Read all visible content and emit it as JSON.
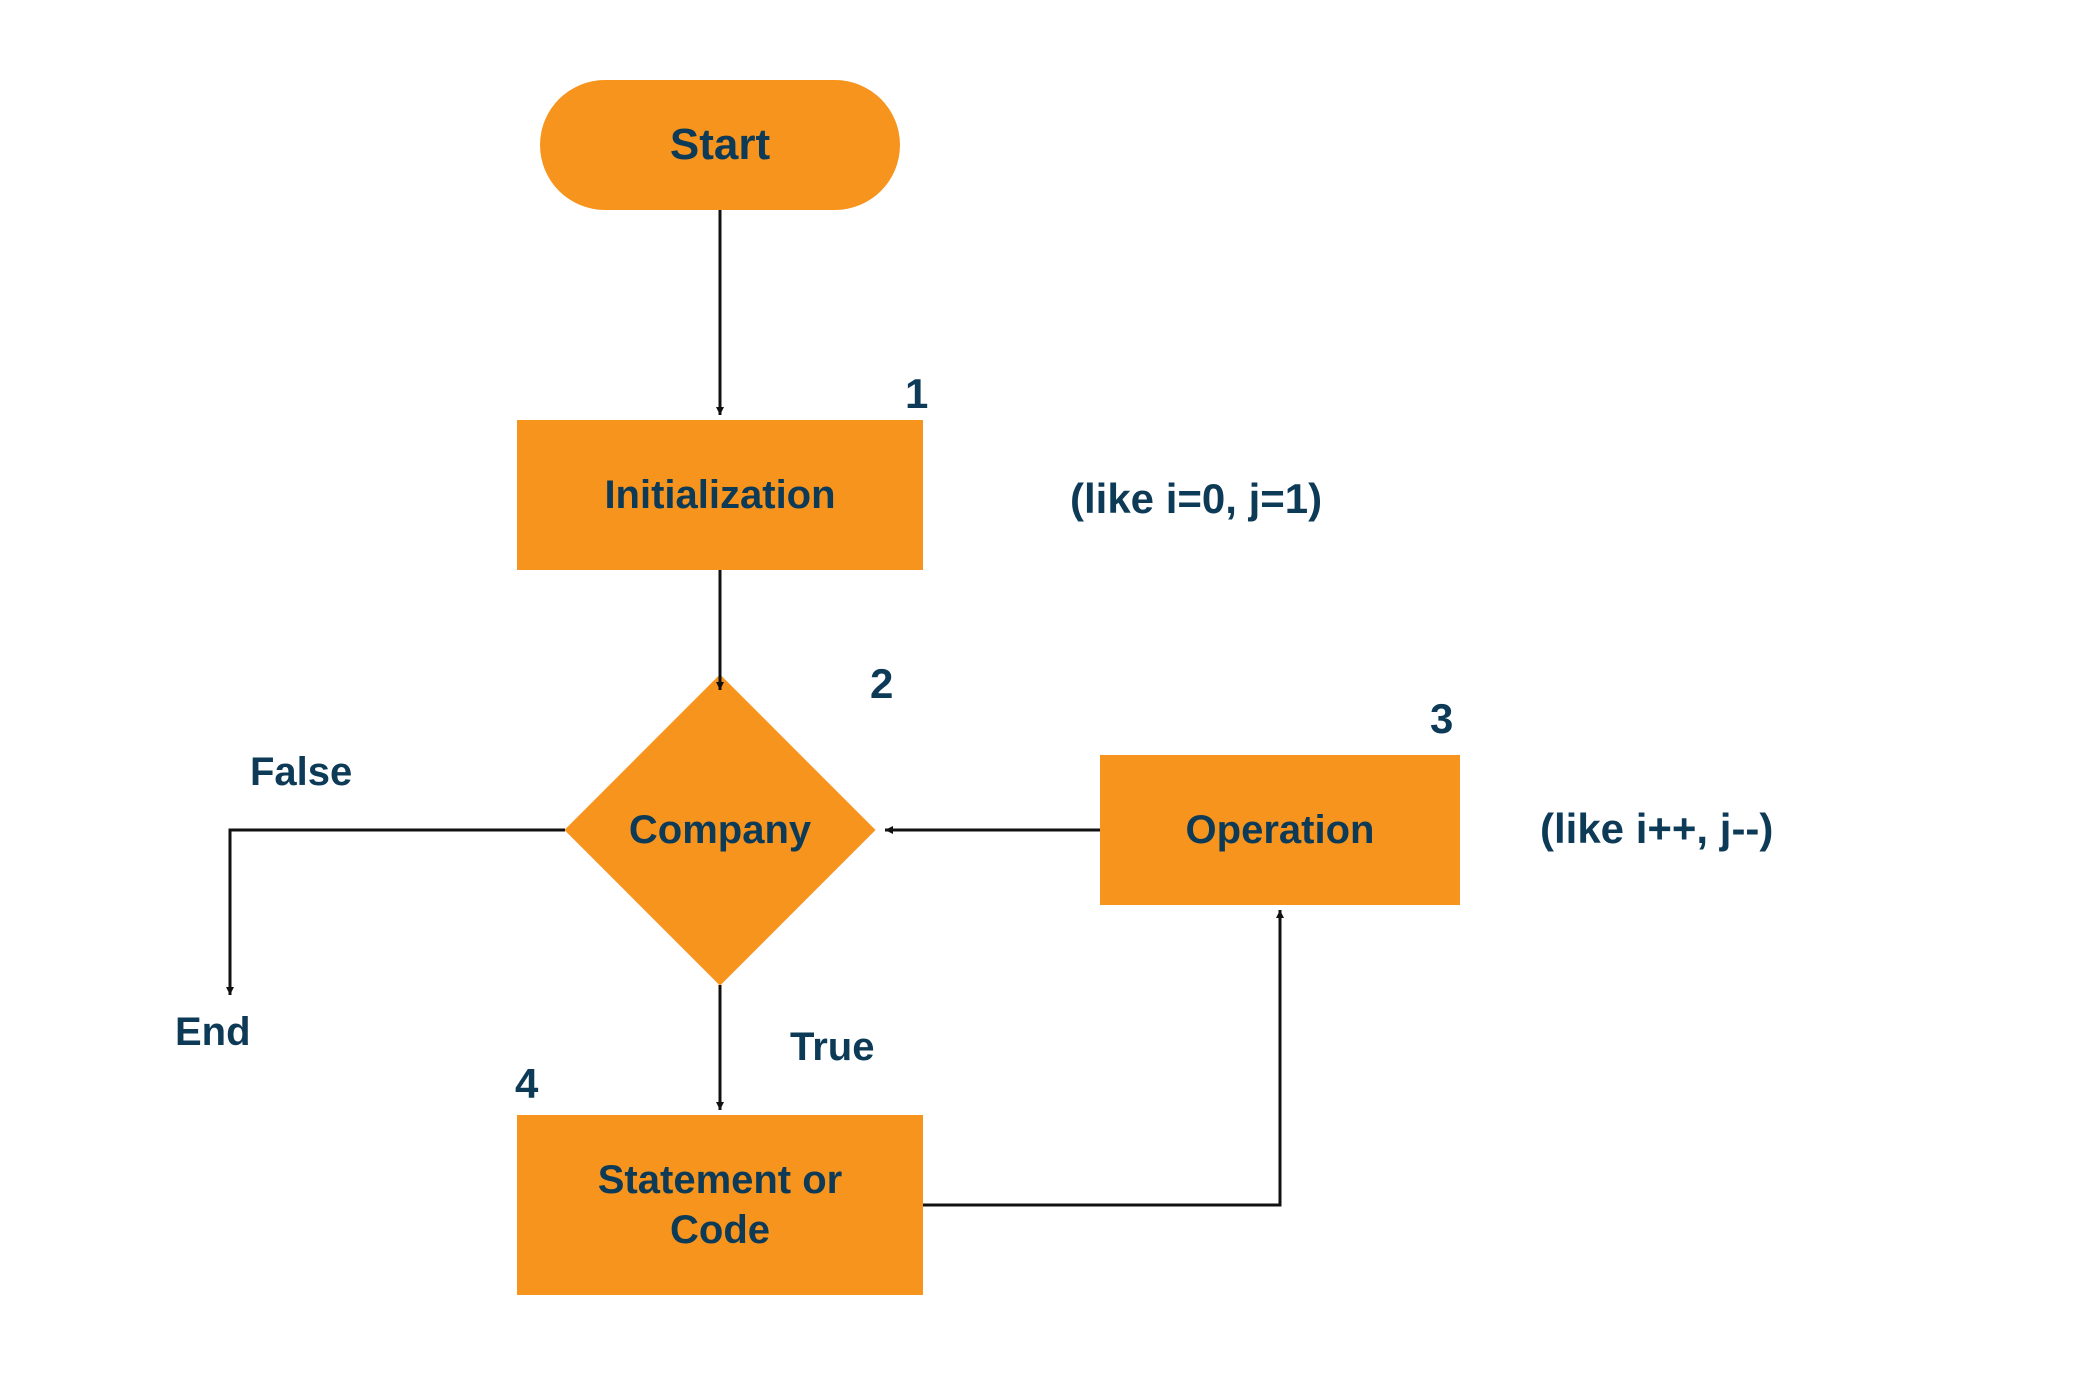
{
  "nodes": {
    "start": {
      "label": "Start"
    },
    "init": {
      "label": "Initialization",
      "num": "1",
      "note": "(like i=0, j=1)"
    },
    "cond": {
      "label": "Company",
      "num": "2"
    },
    "op": {
      "label": "Operation",
      "num": "3",
      "note": "(like i++, j--)"
    },
    "stmt": {
      "label": "Statement or\nCode",
      "num": "4"
    }
  },
  "edges": {
    "false_label": "False",
    "true_label": "True",
    "end_label": "End"
  },
  "colors": {
    "fill": "#f7941d",
    "text": "#0d3a56",
    "line": "#111111"
  }
}
